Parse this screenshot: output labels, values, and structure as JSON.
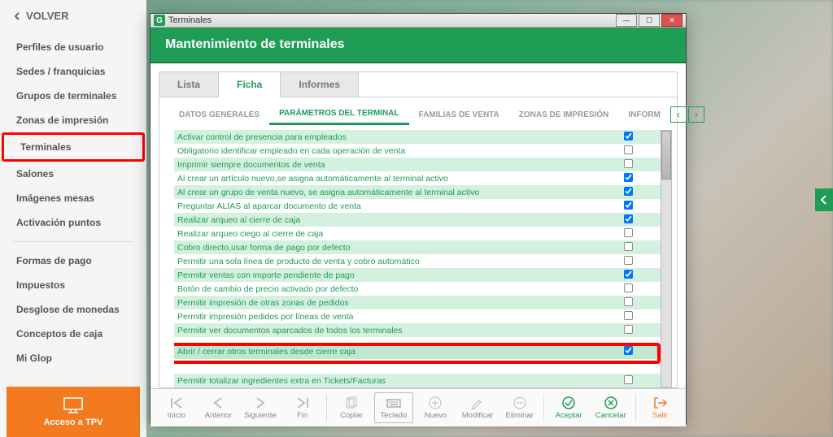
{
  "back_label": "VOLVER",
  "sidebar": {
    "items": [
      "Perfiles de usuario",
      "Sedes / franquicias",
      "Grupos de terminales",
      "Zonas de impresión",
      "Terminales",
      "Salones",
      "Imágenes mesas",
      "Activación puntos"
    ],
    "items2": [
      "Formas de pago",
      "Impuestos",
      "Desglose de monedas",
      "Conceptos de caja",
      "Mi Glop"
    ],
    "highlighted_index": 4
  },
  "tpv_label": "Acceso a TPV",
  "window": {
    "app_letter": "G",
    "title": "Terminales",
    "heading": "Mantenimiento de terminales",
    "tabs": [
      "Lista",
      "Ficha",
      "Informes"
    ],
    "active_tab": 1,
    "subtabs": [
      "DATOS GENERALES",
      "PARÁMETROS DEL TERMINAL",
      "FAMILIAS DE VENTA",
      "ZONAS DE IMPRESIÓN",
      "INFORM"
    ],
    "active_subtab": 1
  },
  "params": [
    {
      "label": "Activar control de presencia para empleados",
      "checked": true
    },
    {
      "label": "Obligatorio identificar empleado en cada operación de venta",
      "checked": false
    },
    {
      "label": "Imprimir siempre documentos de venta",
      "checked": false
    },
    {
      "label": "Al crear un artículo nuevo,se asigna automáticamente al terminal activo",
      "checked": true
    },
    {
      "label": "Al crear un grupo de venta nuevo, se asigna automáticamente al terminal activo",
      "checked": true
    },
    {
      "label": "Preguntar ALIAS al aparcar documento de venta",
      "checked": true
    },
    {
      "label": "Realizar arqueo al cierre de caja",
      "checked": true
    },
    {
      "label": "Realizar arqueo ciego al cierre de caja",
      "checked": false
    },
    {
      "label": "Cobro directo,usar forma de pago por defecto",
      "checked": false
    },
    {
      "label": "Permitir una sola línea de producto de venta y cobro automático",
      "checked": false
    },
    {
      "label": "Permitir ventas con importe pendiente de pago",
      "checked": true
    },
    {
      "label": "Botón de cambio de precio activado por defecto",
      "checked": false
    },
    {
      "label": "Permitir impresión de otras zonas de pedidos",
      "checked": false
    },
    {
      "label": "Permitir impresión pedidos por líneas de venta",
      "checked": false
    },
    {
      "label": "Permitir ver documentos aparcados de todos los terminales",
      "checked": false
    }
  ],
  "param_highlighted": {
    "label": "Abrir / cerrar otros terminales desde cierre caja",
    "checked": true
  },
  "param_bottom": {
    "label": "Permitir totalizar ingredientes extra en Tickets/Facturas",
    "checked": false
  },
  "toolbar": {
    "inicio": "Inicio",
    "anterior": "Anterior",
    "siguiente": "Siguiente",
    "fin": "Fin",
    "copiar": "Copiar",
    "teclado": "Teclado",
    "nuevo": "Nuevo",
    "modificar": "Modificar",
    "eliminar": "Eliminar",
    "aceptar": "Aceptar",
    "cancelar": "Cancelar",
    "salir": "Salir"
  }
}
